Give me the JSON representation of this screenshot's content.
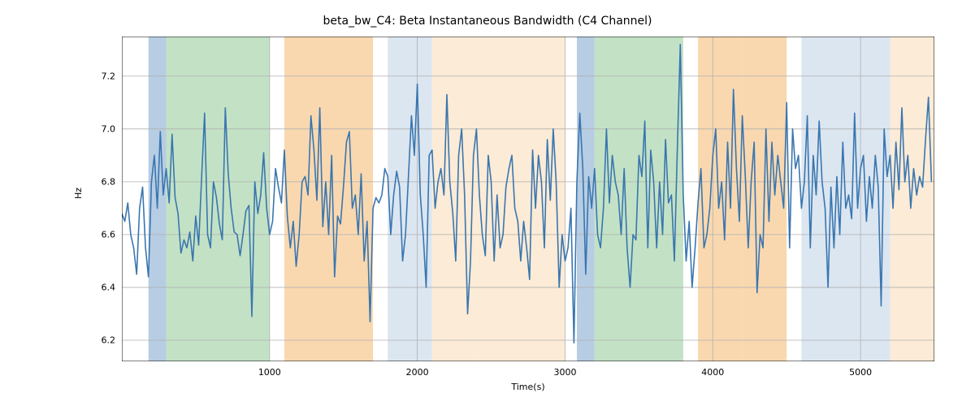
{
  "chart_data": {
    "type": "line",
    "title": "beta_bw_C4: Beta Instantaneous Bandwidth (C4 Channel)",
    "xlabel": "Time(s)",
    "ylabel": "Hz",
    "xlim": [
      0,
      5500
    ],
    "ylim": [
      6.12,
      7.35
    ],
    "xticks": [
      1000,
      2000,
      3000,
      4000,
      5000
    ],
    "yticks": [
      6.2,
      6.4,
      6.6,
      6.8,
      7.0,
      7.2
    ],
    "regions": [
      {
        "x0": 180,
        "x1": 300,
        "color": "#b7cde3"
      },
      {
        "x0": 300,
        "x1": 1000,
        "color": "#c3e2c5"
      },
      {
        "x0": 1100,
        "x1": 1700,
        "color": "#f9d8b0"
      },
      {
        "x0": 1800,
        "x1": 2100,
        "color": "#dbe6f1"
      },
      {
        "x0": 2100,
        "x1": 2400,
        "color": "#fcebd6"
      },
      {
        "x0": 2400,
        "x1": 3000,
        "color": "#fcebd6"
      },
      {
        "x0": 3080,
        "x1": 3200,
        "color": "#b7cde3"
      },
      {
        "x0": 3200,
        "x1": 3800,
        "color": "#c3e2c5"
      },
      {
        "x0": 3900,
        "x1": 4200,
        "color": "#f9d8b0"
      },
      {
        "x0": 4200,
        "x1": 4500,
        "color": "#f9d8b0"
      },
      {
        "x0": 4600,
        "x1": 5200,
        "color": "#dbe6f1"
      },
      {
        "x0": 5200,
        "x1": 5500,
        "color": "#fcebd6"
      }
    ],
    "series": [
      {
        "name": "beta_bw_C4",
        "color": "#3a76af",
        "x_step": 20,
        "values": [
          6.68,
          6.65,
          6.72,
          6.6,
          6.55,
          6.45,
          6.7,
          6.78,
          6.55,
          6.44,
          6.8,
          6.9,
          6.7,
          6.99,
          6.75,
          6.85,
          6.72,
          6.98,
          6.74,
          6.68,
          6.53,
          6.58,
          6.55,
          6.61,
          6.5,
          6.67,
          6.56,
          6.82,
          7.06,
          6.6,
          6.55,
          6.8,
          6.74,
          6.64,
          6.58,
          7.08,
          6.83,
          6.7,
          6.61,
          6.6,
          6.52,
          6.6,
          6.69,
          6.71,
          6.29,
          6.8,
          6.68,
          6.75,
          6.91,
          6.7,
          6.6,
          6.65,
          6.85,
          6.78,
          6.72,
          6.92,
          6.67,
          6.55,
          6.65,
          6.48,
          6.6,
          6.8,
          6.82,
          6.75,
          7.05,
          6.92,
          6.73,
          7.08,
          6.63,
          6.8,
          6.6,
          6.9,
          6.44,
          6.67,
          6.64,
          6.78,
          6.95,
          6.99,
          6.7,
          6.75,
          6.6,
          6.83,
          6.5,
          6.65,
          6.27,
          6.7,
          6.74,
          6.72,
          6.75,
          6.85,
          6.82,
          6.6,
          6.75,
          6.84,
          6.78,
          6.5,
          6.6,
          6.82,
          7.05,
          6.9,
          7.17,
          6.75,
          6.6,
          6.4,
          6.9,
          6.92,
          6.7,
          6.8,
          6.85,
          6.75,
          7.13,
          6.8,
          6.68,
          6.5,
          6.9,
          7.0,
          6.75,
          6.3,
          6.5,
          6.9,
          7.0,
          6.75,
          6.6,
          6.52,
          6.9,
          6.8,
          6.5,
          6.75,
          6.55,
          6.6,
          6.78,
          6.85,
          6.9,
          6.7,
          6.65,
          6.5,
          6.65,
          6.55,
          6.43,
          6.92,
          6.7,
          6.9,
          6.8,
          6.55,
          6.96,
          6.73,
          7.0,
          6.8,
          6.4,
          6.6,
          6.5,
          6.55,
          6.7,
          6.19,
          6.8,
          7.06,
          6.85,
          6.45,
          6.82,
          6.7,
          6.85,
          6.6,
          6.55,
          6.7,
          7.0,
          6.72,
          6.9,
          6.8,
          6.75,
          6.6,
          6.85,
          6.55,
          6.4,
          6.6,
          6.58,
          6.9,
          6.82,
          7.03,
          6.55,
          6.92,
          6.8,
          6.55,
          6.8,
          6.6,
          6.96,
          6.72,
          6.75,
          6.5,
          6.92,
          7.32,
          6.75,
          6.5,
          6.65,
          6.4,
          6.55,
          6.72,
          6.85,
          6.55,
          6.6,
          6.7,
          6.9,
          7.0,
          6.7,
          6.8,
          6.58,
          6.95,
          6.7,
          7.15,
          6.85,
          6.65,
          7.05,
          6.82,
          6.55,
          6.8,
          6.95,
          6.38,
          6.6,
          6.55,
          7.0,
          6.65,
          6.95,
          6.75,
          6.9,
          6.8,
          6.7,
          7.1,
          6.55,
          7.0,
          6.85,
          6.9,
          6.7,
          6.8,
          7.05,
          6.55,
          6.9,
          6.75,
          7.03,
          6.8,
          6.7,
          6.4,
          6.78,
          6.55,
          6.82,
          6.6,
          6.95,
          6.7,
          6.75,
          6.66,
          7.06,
          6.7,
          6.85,
          6.9,
          6.65,
          6.82,
          6.7,
          6.9,
          6.78,
          6.33,
          7.0,
          6.82,
          6.9,
          6.7,
          6.95,
          6.77,
          7.08,
          6.8,
          6.9,
          6.7,
          6.85,
          6.75,
          6.82,
          6.78,
          6.96,
          7.12,
          6.8
        ]
      }
    ]
  }
}
